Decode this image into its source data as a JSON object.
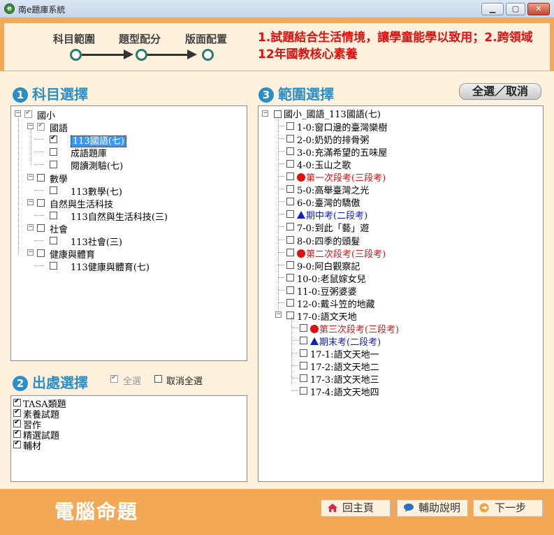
{
  "window": {
    "title": "南e題庫系統",
    "icon": "app-logo-icon"
  },
  "wizard": {
    "steps": [
      {
        "label": "科目範圍"
      },
      {
        "label": "題型配分"
      },
      {
        "label": "版面配置"
      }
    ],
    "notice_line1": "1.試題結合生活情境，讓學童能學以致用；2.跨領域",
    "notice_line2": "12年國教核心素養"
  },
  "subject_panel": {
    "heading_num": "1",
    "heading": "科目選擇",
    "tree": [
      {
        "label": "國小",
        "checked": true,
        "grey": true
      },
      {
        "label": "國語",
        "checked": true,
        "grey": true
      },
      {
        "label": "113國語(七)",
        "checked": true,
        "selected": true
      },
      {
        "label": "成語題庫",
        "checked": false
      },
      {
        "label": "閱讀測驗(七)",
        "checked": false
      },
      {
        "label": "數學",
        "checked": false
      },
      {
        "label": "113數學(七)",
        "checked": false
      },
      {
        "label": "自然與生活科技",
        "checked": false
      },
      {
        "label": "113自然與生活科技(三)",
        "checked": false
      },
      {
        "label": "社會",
        "checked": false
      },
      {
        "label": "113社會(三)",
        "checked": false
      },
      {
        "label": "健康與體育",
        "checked": false
      },
      {
        "label": "113健康與體育(七)",
        "checked": false
      }
    ]
  },
  "source_panel": {
    "heading_num": "2",
    "heading": "出處選擇",
    "select_all": "全選",
    "deselect_all": "取消全選",
    "items": [
      "TASA類題",
      "素養試題",
      "習作",
      "精選試題",
      "輔材"
    ]
  },
  "range_panel": {
    "heading_num": "3",
    "heading": "範圍選擇",
    "toggle_button": "全選／取消",
    "root": "國小_國語_113國語(七)",
    "items": [
      {
        "label": "1-0:窗口邊的臺灣欒樹",
        "kind": "normal"
      },
      {
        "label": "2-0:奶奶的排骨粥",
        "kind": "normal"
      },
      {
        "label": "3-0:充滿希望的五味屋",
        "kind": "normal"
      },
      {
        "label": "4-0:玉山之歌",
        "kind": "normal"
      },
      {
        "label": "第一次段考(三段考)",
        "kind": "red"
      },
      {
        "label": "5-0:高舉臺灣之光",
        "kind": "normal"
      },
      {
        "label": "6-0:臺灣的驕傲",
        "kind": "normal"
      },
      {
        "label": "期中考(二段考)",
        "kind": "blue"
      },
      {
        "label": "7-0:到此「藝」遊",
        "kind": "normal"
      },
      {
        "label": "8-0:四季的頭髮",
        "kind": "normal"
      },
      {
        "label": "第二次段考(三段考)",
        "kind": "red"
      },
      {
        "label": "9-0:阿白觀察記",
        "kind": "normal"
      },
      {
        "label": "10-0:老鼠嫁女兒",
        "kind": "normal"
      },
      {
        "label": "11-0:豆粥婆婆",
        "kind": "normal"
      },
      {
        "label": "12-0:戴斗笠的地藏",
        "kind": "normal"
      },
      {
        "label": "17-0:語文天地",
        "kind": "normal"
      }
    ],
    "sub_items": [
      {
        "label": "第三次段考(三段考)",
        "kind": "red"
      },
      {
        "label": "期末考(二段考)",
        "kind": "blue"
      },
      {
        "label": "17-1:語文天地一",
        "kind": "normal"
      },
      {
        "label": "17-2:語文天地二",
        "kind": "normal"
      },
      {
        "label": "17-3:語文天地三",
        "kind": "normal"
      },
      {
        "label": "17-4:語文天地四",
        "kind": "normal"
      }
    ]
  },
  "footer": {
    "brand": "電腦命題",
    "home": "回主頁",
    "help": "輔助說明",
    "next": "下一步"
  },
  "colors": {
    "accent": "#f2a854",
    "heading": "#2a8fc8",
    "notice": "#e01010",
    "step": "#2a7a6a"
  }
}
